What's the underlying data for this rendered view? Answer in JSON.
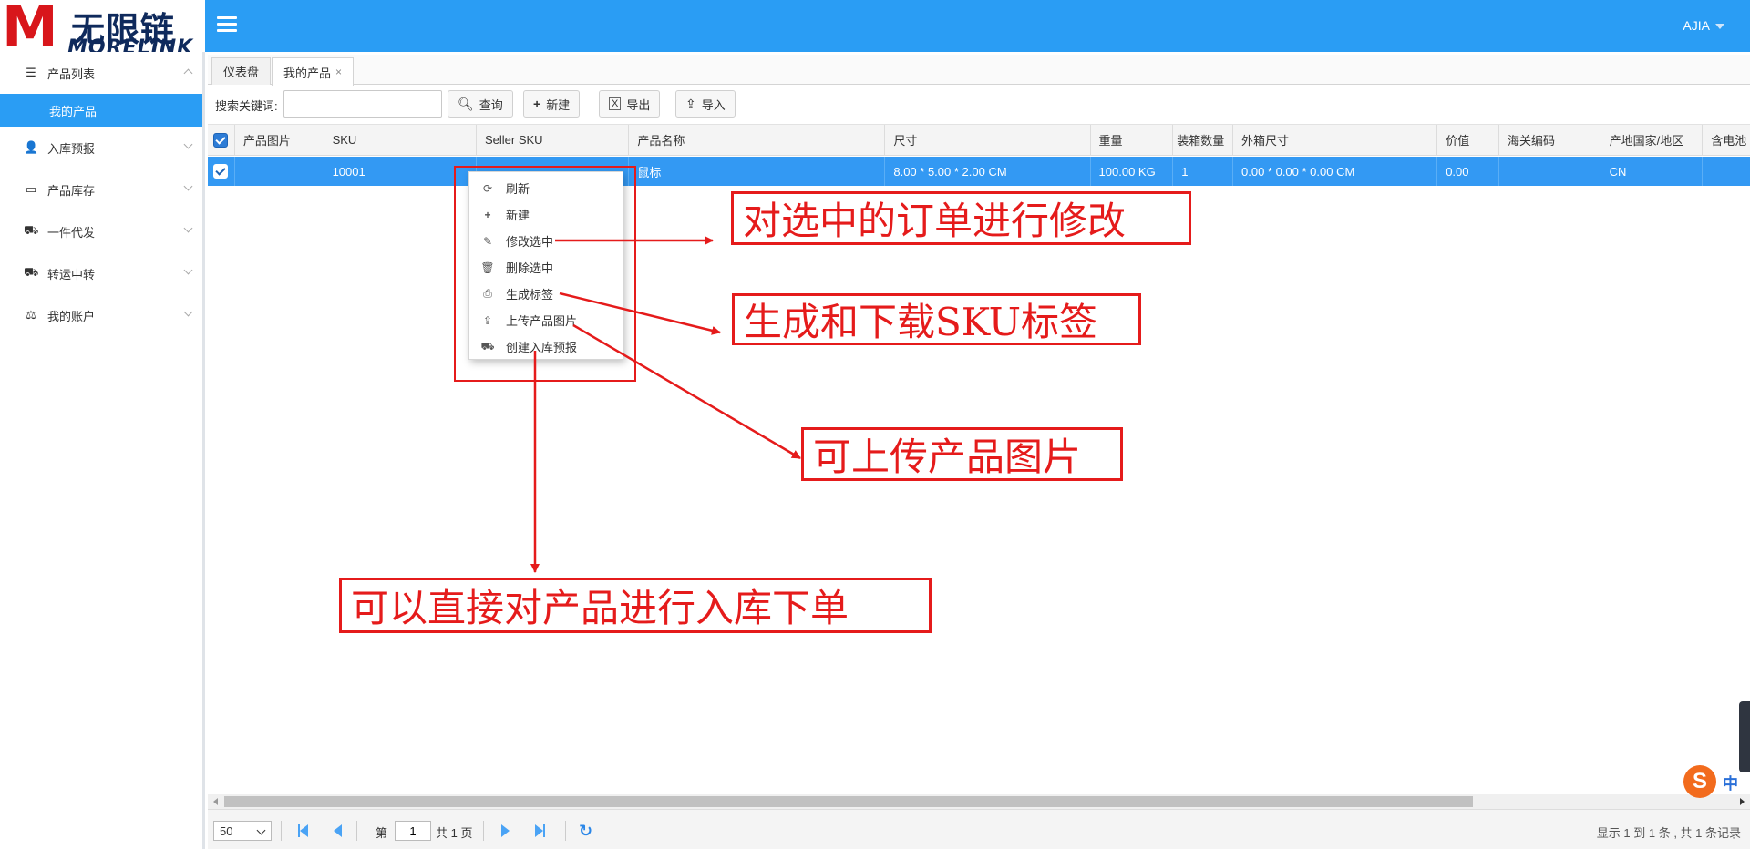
{
  "header": {
    "logo_cn": "无限链接",
    "logo_en": "MORELINK",
    "user": "AJIA"
  },
  "sidebar": {
    "items": [
      {
        "label": "产品列表",
        "icon": "list-icon"
      },
      {
        "label": "我的产品",
        "icon": ""
      },
      {
        "label": "入库预报",
        "icon": "person-icon"
      },
      {
        "label": "产品库存",
        "icon": "inbox-icon"
      },
      {
        "label": "一件代发",
        "icon": "truck-icon"
      },
      {
        "label": "转运中转",
        "icon": "truck-icon"
      },
      {
        "label": "我的账户",
        "icon": "scale-icon"
      }
    ]
  },
  "tabs": [
    {
      "label": "仪表盘"
    },
    {
      "label": "我的产品",
      "close": "×"
    }
  ],
  "toolbar": {
    "search_label": "搜索关键词:",
    "search_value": "",
    "query": "查询",
    "new": "新建",
    "export": "导出",
    "import": "导入"
  },
  "grid": {
    "columns": [
      "产品图片",
      "SKU",
      "Seller SKU",
      "产品名称",
      "尺寸",
      "重量",
      "装箱数量",
      "外箱尺寸",
      "价值",
      "海关编码",
      "产地国家/地区",
      "含电池"
    ],
    "row": [
      "",
      "10001",
      "",
      "鼠标",
      "8.00 * 5.00 * 2.00 CM",
      "100.00 KG",
      "1",
      "0.00 * 0.00 * 0.00 CM",
      "0.00",
      "",
      "CN",
      ""
    ]
  },
  "context_menu": [
    {
      "label": "刷新",
      "icon": "refresh-icon"
    },
    {
      "label": "新建",
      "icon": "plus-icon"
    },
    {
      "label": "修改选中",
      "icon": "pencil-icon"
    },
    {
      "label": "删除选中",
      "icon": "trash-icon"
    },
    {
      "label": "生成标签",
      "icon": "print-icon"
    },
    {
      "label": "上传产品图片",
      "icon": "upload-icon"
    },
    {
      "label": "创建入库预报",
      "icon": "truck-icon"
    }
  ],
  "annotations": {
    "edit": "对选中的订单进行修改",
    "label": "生成和下载SKU标签",
    "upload": "可上传产品图片",
    "inbound": "可以直接对产品进行入库下单"
  },
  "pager": {
    "page_size": "50",
    "page_prefix": "第",
    "page": "1",
    "page_suffix": "共 1 页",
    "summary": "显示 1 到 1 条 , 共 1 条记录"
  },
  "ime": {
    "s": "S",
    "zh": "中"
  },
  "colors": {
    "primary": "#2a9df4",
    "selected_row": "#3399f3",
    "annotation": "#e51b1b"
  }
}
